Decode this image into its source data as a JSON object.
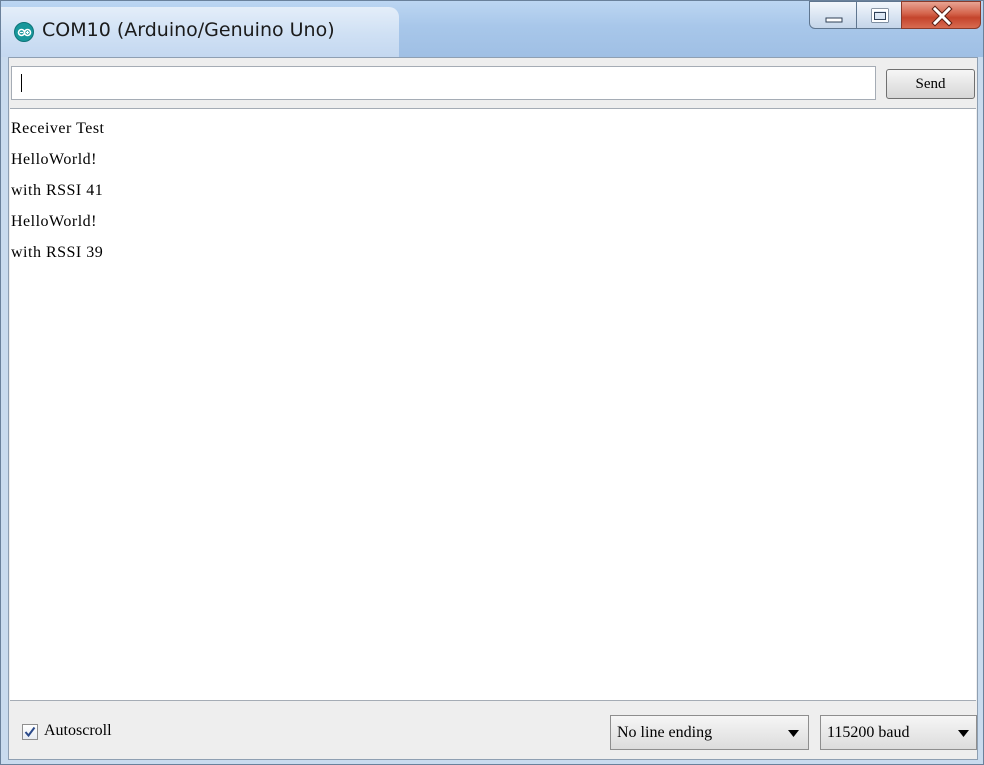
{
  "window": {
    "title": "COM10 (Arduino/Genuino Uno)",
    "icon": "arduino-icon"
  },
  "input": {
    "value": "",
    "send_label": "Send"
  },
  "output": {
    "lines": [
      "Receiver Test",
      "HelloWorld!",
      "with RSSI 41",
      "HelloWorld!",
      "with RSSI 39"
    ]
  },
  "footer": {
    "autoscroll_label": "Autoscroll",
    "autoscroll_checked": true,
    "line_ending": "No line ending",
    "baud_rate": "115200 baud"
  }
}
